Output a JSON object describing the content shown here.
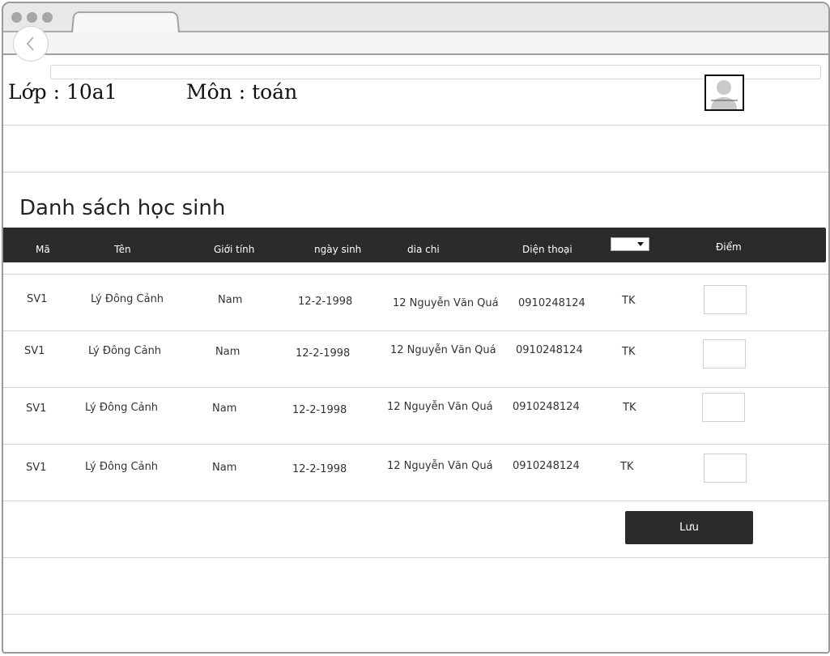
{
  "header": {
    "class_label": "Lớp : 10a1",
    "subject_label": "Môn : toán"
  },
  "heading": "Danh sách học sinh",
  "table": {
    "columns": [
      "Mã",
      "Tên",
      "Giới tính",
      "ngày sinh",
      "dia chi",
      "Diện thoại",
      "Điểm"
    ],
    "rows": [
      {
        "id": "SV1",
        "name": "Lý Đông Cảnh",
        "gender": "Nam",
        "dob": "12-2-1998",
        "address": "12 Nguyễn Văn Quá",
        "phone": "0910248124",
        "type": "TK"
      },
      {
        "id": "SV1",
        "name": "Lý Đông Cảnh",
        "gender": "Nam",
        "dob": "12-2-1998",
        "address": "12 Nguyễn Văn Quá",
        "phone": "0910248124",
        "type": "TK"
      },
      {
        "id": "SV1",
        "name": "Lý Đông Cảnh",
        "gender": "Nam",
        "dob": "12-2-1998",
        "address": "12 Nguyễn Văn Quá",
        "phone": "0910248124",
        "type": "TK"
      },
      {
        "id": "SV1",
        "name": "Lý Đông Cảnh",
        "gender": "Nam",
        "dob": "12-2-1998",
        "address": "12 Nguyễn Văn Quá",
        "phone": "0910248124",
        "type": "TK"
      }
    ]
  },
  "save_label": "Lưu",
  "icons": {
    "back": "chevron-left-icon",
    "avatar": "user-avatar-icon",
    "dropdown": "dropdown-arrow-icon"
  },
  "colors": {
    "header_bar": "#2b2b2b",
    "button": "#2b2b2b"
  }
}
